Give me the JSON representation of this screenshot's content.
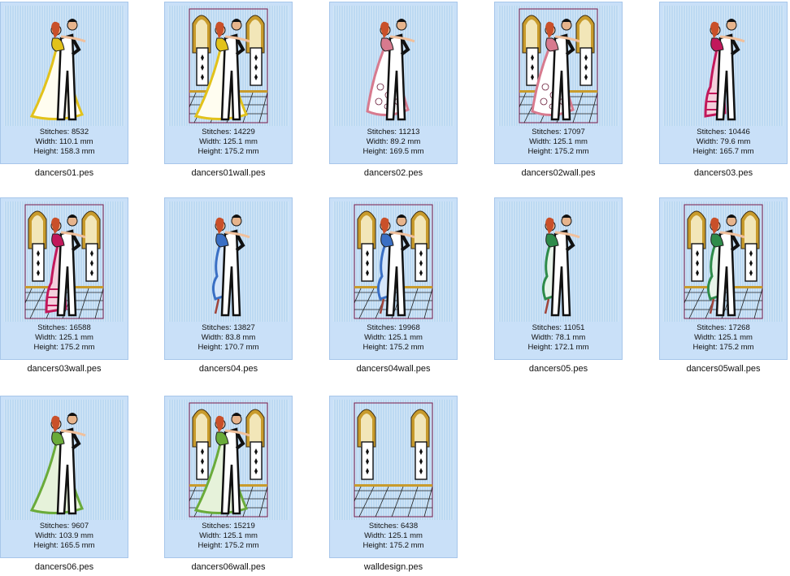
{
  "labels": {
    "stitches": "Stitches: ",
    "width": "Width: ",
    "height": "Height: "
  },
  "files": [
    {
      "name": "dancers01.pes",
      "stitches": "8532",
      "width": "110.1 mm",
      "height": "158.3 mm",
      "wall": false,
      "dress": "#e2c21b",
      "style": "gown"
    },
    {
      "name": "dancers01wall.pes",
      "stitches": "14229",
      "width": "125.1 mm",
      "height": "175.2 mm",
      "wall": true,
      "dress": "#e2c21b",
      "style": "gown"
    },
    {
      "name": "dancers02.pes",
      "stitches": "11213",
      "width": "89.2 mm",
      "height": "169.5 mm",
      "wall": false,
      "dress": "#d77a8e",
      "style": "lace"
    },
    {
      "name": "dancers02wall.pes",
      "stitches": "17097",
      "width": "125.1 mm",
      "height": "175.2 mm",
      "wall": true,
      "dress": "#d77a8e",
      "style": "lace"
    },
    {
      "name": "dancers03.pes",
      "stitches": "10446",
      "width": "79.6 mm",
      "height": "165.7 mm",
      "wall": false,
      "dress": "#c2185b",
      "style": "flamenco"
    },
    {
      "name": "dancers03wall.pes",
      "stitches": "16588",
      "width": "125.1 mm",
      "height": "175.2 mm",
      "wall": true,
      "dress": "#c2185b",
      "style": "flamenco"
    },
    {
      "name": "dancers04.pes",
      "stitches": "13827",
      "width": "83.8 mm",
      "height": "170.7 mm",
      "wall": false,
      "dress": "#3a6fc4",
      "style": "tango"
    },
    {
      "name": "dancers04wall.pes",
      "stitches": "19968",
      "width": "125.1 mm",
      "height": "175.2 mm",
      "wall": true,
      "dress": "#3a6fc4",
      "style": "tango"
    },
    {
      "name": "dancers05.pes",
      "stitches": "11051",
      "width": "78.1 mm",
      "height": "172.1 mm",
      "wall": false,
      "dress": "#2e8b4a",
      "style": "latin"
    },
    {
      "name": "dancers05wall.pes",
      "stitches": "17268",
      "width": "125.1 mm",
      "height": "175.2 mm",
      "wall": true,
      "dress": "#2e8b4a",
      "style": "latin"
    },
    {
      "name": "dancers06.pes",
      "stitches": "9607",
      "width": "103.9 mm",
      "height": "165.5 mm",
      "wall": false,
      "dress": "#6aab3a",
      "style": "gown"
    },
    {
      "name": "dancers06wall.pes",
      "stitches": "15219",
      "width": "125.1 mm",
      "height": "175.2 mm",
      "wall": true,
      "dress": "#6aab3a",
      "style": "gown"
    },
    {
      "name": "walldesign.pes",
      "stitches": "6438",
      "width": "125.1 mm",
      "height": "175.2 mm",
      "wall": true,
      "dress": "",
      "style": "none"
    }
  ]
}
